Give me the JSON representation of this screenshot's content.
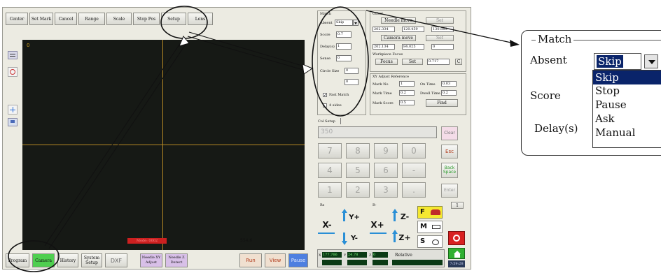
{
  "toolbar": {
    "center": "Center",
    "set_mark": "Set Mark",
    "cancel": "Cancel",
    "range": "Range",
    "scale": "Scale",
    "stop_pos": "Stop Pos",
    "setup": "Setup",
    "lens": "Lens"
  },
  "viewer": {
    "channel_label": "0",
    "status_red": "Mode: 0002",
    "coord_readout": "554,6"
  },
  "bottom_bar": {
    "program": "Program",
    "camera": "Camera",
    "history": "History",
    "system_setup": "System Setup",
    "dxf": "DXF",
    "needle_xy_adjust": "Needle XY Adjust",
    "needle_z_detect": "Needle Z Detect",
    "run": "Run",
    "view": "View",
    "pause": "Pause"
  },
  "match": {
    "title": "Match",
    "absent_label": "Absent",
    "absent_value": "Skip",
    "score_label": "Score",
    "score_value": "0.7",
    "delay_label": "Delay(s)",
    "delay_value": "1",
    "sense_label": "Sense",
    "sense_value": "0",
    "circle_label": "Circle Size",
    "circle_value": "0",
    "circle_value2": "0",
    "fast_match": "Fast Match",
    "four_sides": "4 sides"
  },
  "offset": {
    "title": "Offset",
    "needle_move": "Needle move",
    "set": "Set",
    "needle_vals": [
      "202.334",
      "120.459",
      "130.883"
    ],
    "camera_move": "Camera move",
    "set2": "Set",
    "camera_vals": [
      "202.134",
      "84.025",
      "0"
    ],
    "workpiece_focus": "Workpiece Focus",
    "focus": "Focus",
    "set3": "Set",
    "focus_val": "0.717",
    "c_btn": "C"
  },
  "xy_adjust": {
    "title": "XY Adjust Reference",
    "mark_no": "Mark No",
    "mark_no_val": "1",
    "on_time": "On Time",
    "on_time_val": "0.03",
    "mark_time": "Mark Time",
    "mark_time_val": "0.2",
    "dwell_time": "Dwell Time",
    "dwell_time_val": "0.2",
    "mark_score": "Mark Score",
    "mark_score_val": "0.5",
    "find": "Find"
  },
  "keypad": {
    "title": "Col Setup",
    "display": "350",
    "clear": "Clear",
    "esc": "Esc",
    "backspace": "Back Space",
    "enter": "Enter",
    "keys": [
      "7",
      "8",
      "9",
      "0",
      "4",
      "5",
      "6",
      "-",
      "1",
      "2",
      "3",
      "."
    ]
  },
  "jog": {
    "xm": "X-",
    "yp": "Y+",
    "xp": "X+",
    "ym": "Y-",
    "zm": "Z-",
    "zp": "Z+",
    "f_label": "F",
    "m_label": "M",
    "s_label": "S",
    "rs": "Rs",
    "r_minus": "R-",
    "one": "1"
  },
  "status": {
    "x_label": "X",
    "x_val": "177.766",
    "y_label": "Y",
    "y_val": "24.78",
    "z_label": "Z",
    "z_val": "0",
    "relative": "Relative",
    "clock": "7:59:28"
  },
  "callout": {
    "title": "Match",
    "absent": "Absent",
    "selected": "Skip",
    "score": "Score",
    "delay": "Delay(s)",
    "options": [
      "Skip",
      "Stop",
      "Pause",
      "Ask",
      "Manual"
    ]
  },
  "colors": {
    "highlight": "#0a246a",
    "viewer_bg": "#161915",
    "crosshair": "#b88a25",
    "camera_btn": "#4fcf4f",
    "pause_btn": "#4d7fe0"
  }
}
